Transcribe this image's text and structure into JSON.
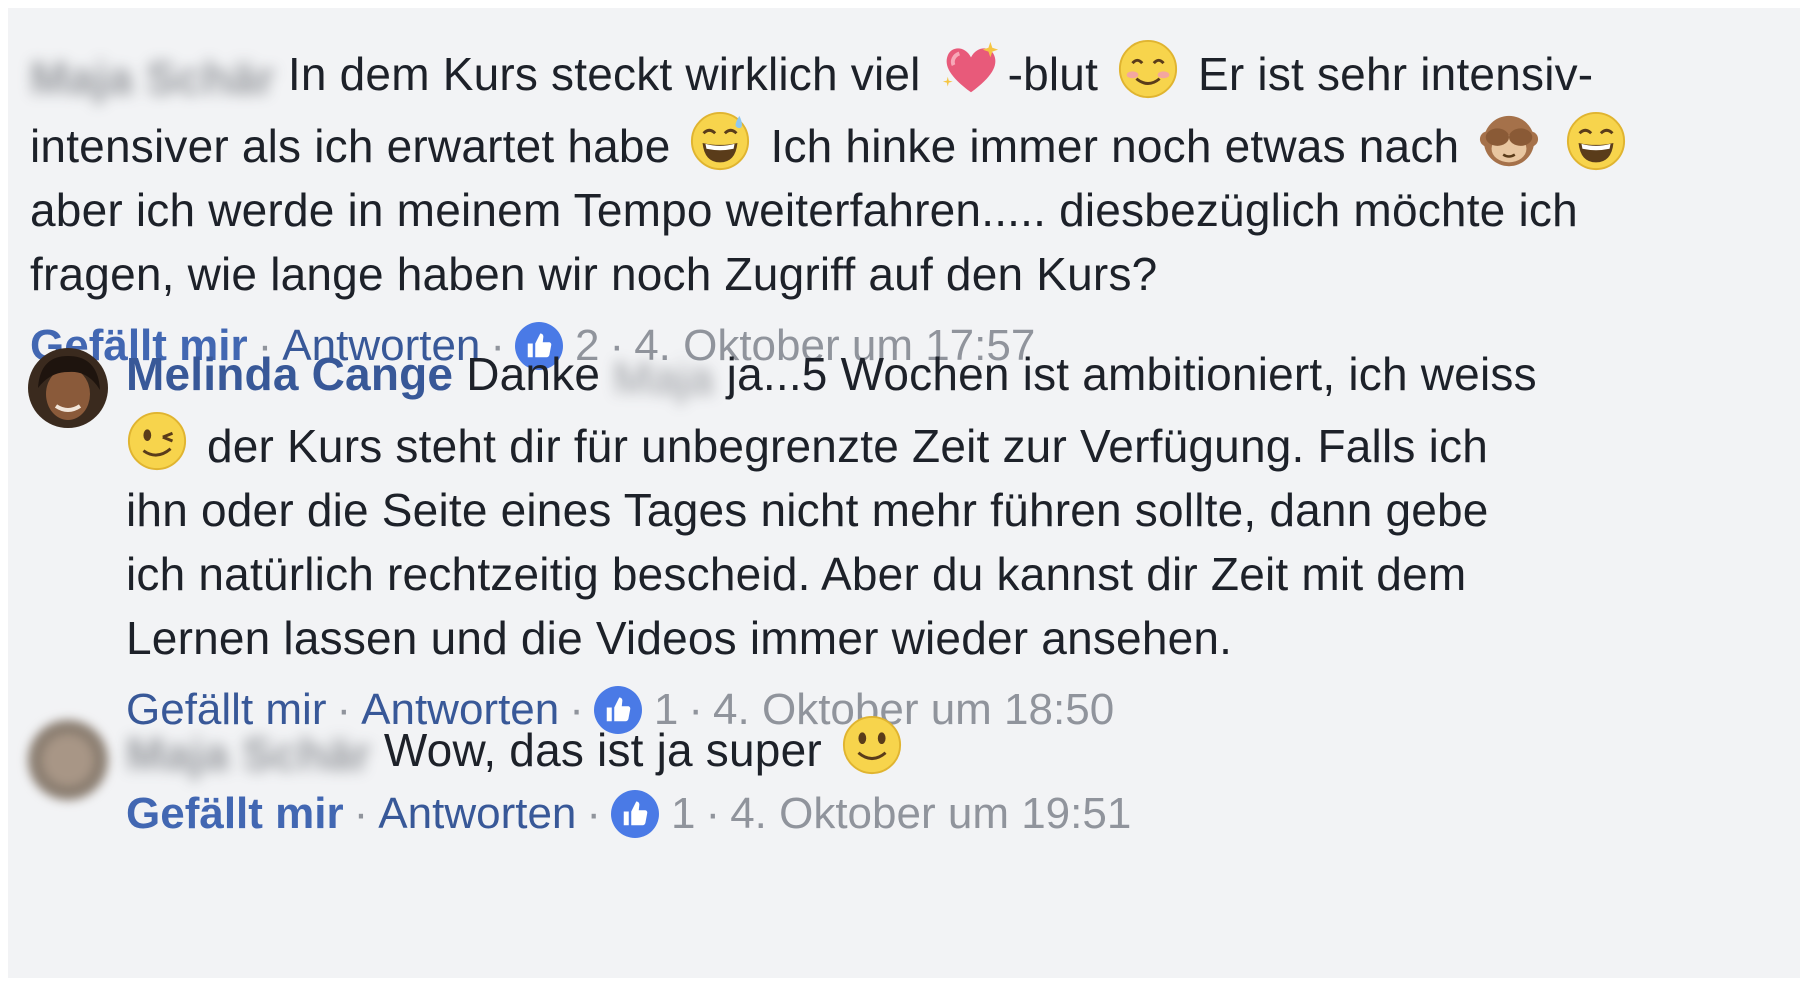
{
  "comments": [
    {
      "author": "Maja Schär",
      "text_part1": "In dem Kurs steckt wirklich viel",
      "text_part2": "-blut",
      "text_part3": "Er ist sehr intensiv-",
      "text_line2a": "intensiver als ich erwartet habe",
      "text_line2b": "Ich hinke immer noch etwas nach",
      "text_line3": "aber ich werde in meinem Tempo weiterfahren..... diesbezüglich möchte ich",
      "text_line4": "fragen, wie lange haben wir noch Zugriff auf den Kurs?",
      "like_label": "Gefällt mir",
      "reply_label": "Antworten",
      "like_count": "2",
      "timestamp": "4. Oktober um 17:57"
    },
    {
      "author": "Melinda Cange",
      "mention": "Maja",
      "text_line1a": "Danke",
      "text_line1b": "ja...5 Wochen ist ambitioniert, ich weiss",
      "text_line2": "der Kurs steht dir für unbegrenzte Zeit zur Verfügung. Falls ich",
      "text_line3": "ihn oder die Seite eines Tages nicht mehr führen sollte, dann gebe",
      "text_line4": "ich natürlich rechtzeitig bescheid. Aber du kannst dir Zeit mit dem",
      "text_line5": "Lernen lassen und die Videos immer wieder ansehen.",
      "like_label": "Gefällt mir",
      "reply_label": "Antworten",
      "like_count": "1",
      "timestamp": "4. Oktober um 18:50"
    },
    {
      "author": "Maja Schär",
      "text": "Wow, das ist ja super",
      "like_label": "Gefällt mir",
      "reply_label": "Antworten",
      "like_count": "1",
      "timestamp": "4. Oktober um 19:51"
    }
  ],
  "icons": {
    "heart": "sparkling-heart-icon",
    "smile": "smiling-face-icon",
    "sweat": "grinning-sweat-icon",
    "monkey": "see-no-evil-monkey-icon",
    "grin": "grinning-face-icon",
    "wink": "winking-face-icon",
    "like": "thumbs-up-icon"
  },
  "colors": {
    "background": "#f2f3f5",
    "text": "#1d2129",
    "name": "#385898",
    "like_link": "#4267b2",
    "meta": "#90949c",
    "like_badge": "#4a7ae6"
  },
  "separator": "·"
}
